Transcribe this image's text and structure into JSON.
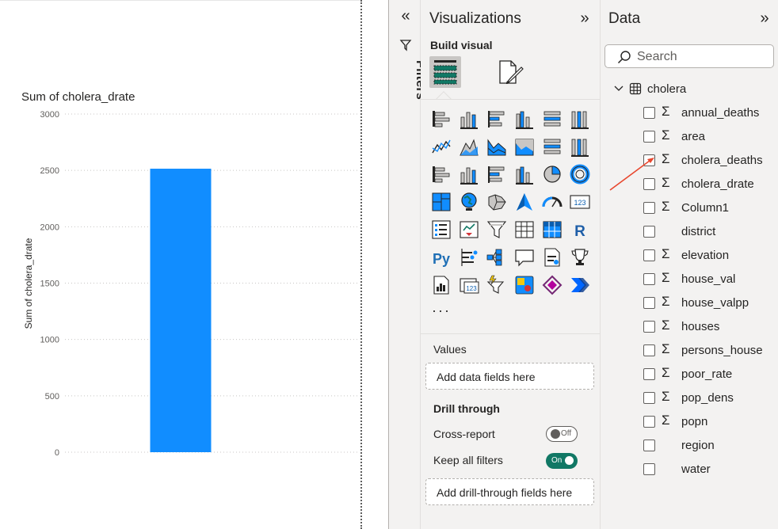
{
  "chart": {
    "title": "Sum of cholera_drate",
    "ylabel": "Sum of cholera_drate"
  },
  "chart_data": {
    "type": "bar",
    "title": "Sum of cholera_drate",
    "xlabel": "",
    "ylabel": "Sum of cholera_drate",
    "categories": [
      ""
    ],
    "values": [
      2515
    ],
    "ylim": [
      0,
      3000
    ],
    "yticks": [
      0,
      500,
      1000,
      1500,
      2000,
      2500,
      3000
    ],
    "grid": true,
    "bar_color": "#118DFF"
  },
  "filters": {
    "label": "Filters",
    "collapse_icon": "double-chevron-left-icon"
  },
  "visualizations": {
    "title": "Visualizations",
    "build_visual_label": "Build visual",
    "more_label": "···",
    "values_label": "Values",
    "values_placeholder": "Add data fields here",
    "drill_through_label": "Drill through",
    "cross_report_label": "Cross-report",
    "cross_report_state": "Off",
    "keep_all_filters_label": "Keep all filters",
    "keep_all_filters_state": "On",
    "drill_placeholder": "Add drill-through fields here",
    "accent_color": "#117865",
    "icons": [
      "stacked-bar-chart-icon",
      "stacked-column-chart-icon",
      "clustered-bar-chart-icon",
      "clustered-column-chart-icon",
      "100-stacked-bar-chart-icon",
      "100-stacked-column-chart-icon",
      "line-chart-icon",
      "area-chart-icon",
      "stacked-area-chart-icon",
      "100-stacked-area-chart-icon",
      "line-clustered-column-chart-icon",
      "line-stacked-column-chart-icon",
      "ribbon-chart-icon",
      "waterfall-chart-icon",
      "funnel-chart-icon",
      "scatter-chart-icon",
      "pie-chart-icon",
      "donut-chart-icon",
      "treemap-icon",
      "map-icon",
      "filled-map-icon",
      "azure-map-icon",
      "gauge-icon",
      "card-icon",
      "multi-row-card-icon",
      "kpi-icon",
      "slicer-icon",
      "table-icon",
      "matrix-icon",
      "r-script-visual-icon",
      "python-visual-icon",
      "key-influencers-icon",
      "decomposition-tree-icon",
      "qa-icon",
      "smart-narrative-icon",
      "metrics-icon",
      "paginated-report-icon",
      "card-new-icon",
      "slicer-new-icon",
      "power-apps-icon",
      "power-automate-icon",
      "power-automate-flow-icon"
    ]
  },
  "data": {
    "title": "Data",
    "search_placeholder": "Search",
    "table_name": "cholera",
    "fields": [
      {
        "name": "annual_deaths",
        "sigma": true
      },
      {
        "name": "area",
        "sigma": true
      },
      {
        "name": "cholera_deaths",
        "sigma": true
      },
      {
        "name": "cholera_drate",
        "sigma": true
      },
      {
        "name": "Column1",
        "sigma": true
      },
      {
        "name": "district",
        "sigma": false
      },
      {
        "name": "elevation",
        "sigma": true
      },
      {
        "name": "house_val",
        "sigma": true
      },
      {
        "name": "house_valpp",
        "sigma": true
      },
      {
        "name": "houses",
        "sigma": true
      },
      {
        "name": "persons_house",
        "sigma": true
      },
      {
        "name": "poor_rate",
        "sigma": true
      },
      {
        "name": "pop_dens",
        "sigma": true
      },
      {
        "name": "popn",
        "sigma": true
      },
      {
        "name": "region",
        "sigma": false
      },
      {
        "name": "water",
        "sigma": false
      }
    ],
    "sigma_symbol": "Σ"
  },
  "annotation": {
    "color": "#E8472E"
  }
}
